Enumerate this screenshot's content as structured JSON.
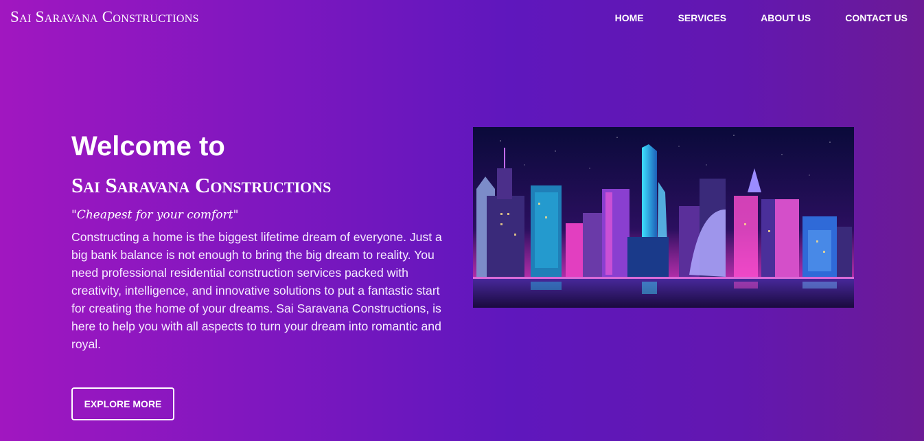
{
  "header": {
    "brand": "Sai Saravana Constructions",
    "nav": [
      "HOME",
      "SERVICES",
      "ABOUT US",
      "CONTACT US"
    ]
  },
  "hero": {
    "welcome": "Welcome to",
    "company": "Sai Saravana Constructions",
    "tagline": "\"Cheapest for your comfort\"",
    "description": "Constructing a home is the biggest lifetime dream of everyone. Just a big bank balance is not enough to bring the big dream to reality. You need professional residential construction services packed with creativity, intelligence, and innovative solutions to put a fantastic start for creating the home of your dreams. Sai Saravana Constructions, is here to help you with all aspects to turn your dream into romantic and royal.",
    "button_label": "EXPLORE MORE",
    "image": "neon-city-skyline-illustration"
  },
  "colors": {
    "gradient": [
      "#a117c0",
      "#5f17bd",
      "#6c1a96"
    ],
    "text": "#ffffff"
  }
}
